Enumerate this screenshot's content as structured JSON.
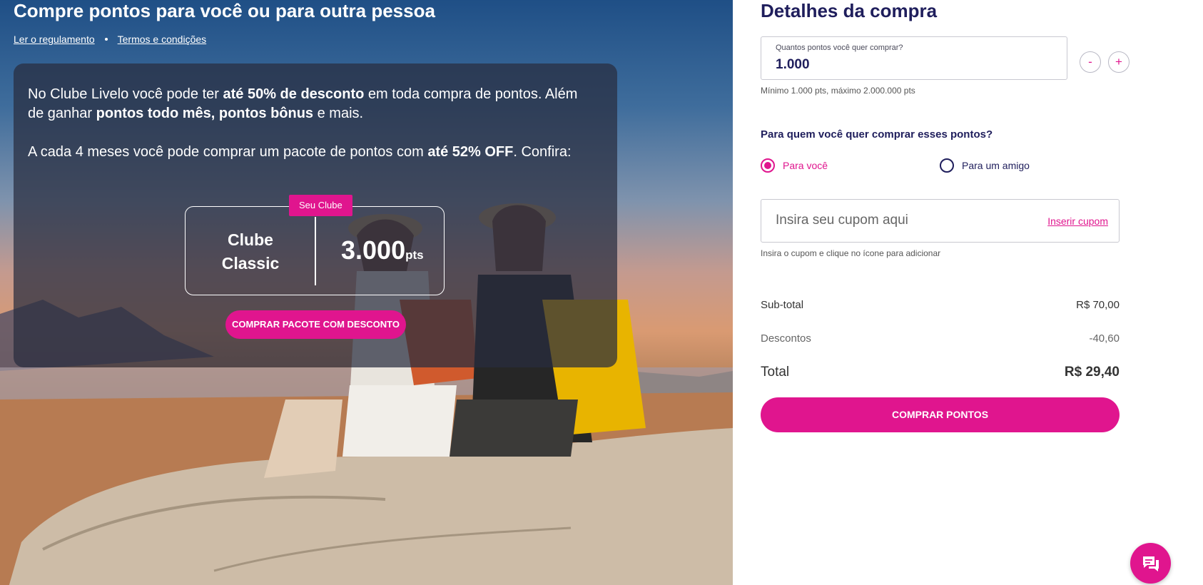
{
  "hero": {
    "title": "Compre pontos para você ou para outra pessoa",
    "links": [
      "Ler o regulamento",
      "Termos e condições"
    ]
  },
  "promo": {
    "p1_parts": [
      "No Clube Livelo você pode ter ",
      "até 50% de desconto",
      " em toda compra de pontos. Além de ganhar ",
      "pontos todo mês, pontos bônus",
      " e mais."
    ],
    "p2_parts": [
      "A cada 4 meses você pode comprar um pacote de pontos com ",
      "até 52% OFF",
      ". Confira:"
    ],
    "badge": "Seu Clube",
    "plan_name": "Clube Classic",
    "points": "3.000",
    "points_unit": "pts",
    "button": "COMPRAR PACOTE COM DESCONTO"
  },
  "panel": {
    "title": "Detalhes da compra",
    "qty_label": "Quantos pontos você quer comprar?",
    "qty_value": "1.000",
    "minus": "-",
    "plus": "+",
    "qty_hint": "Mínimo 1.000 pts, máximo 2.000.000 pts",
    "who_question": "Para quem você quer comprar esses pontos?",
    "radio_you": "Para você",
    "radio_friend": "Para um amigo",
    "coupon_placeholder": "Insira seu cupom aqui",
    "coupon_link": "Inserir cupom",
    "coupon_hint": "Insira o cupom e clique no ícone para adicionar",
    "subtotal_label": "Sub-total",
    "subtotal_value": "R$ 70,00",
    "discount_label": "Descontos",
    "discount_value": "-40,60",
    "total_label": "Total",
    "total_value": "R$ 29,40",
    "buy_button": "COMPRAR PONTOS"
  },
  "colors": {
    "accent": "#e0158e",
    "navy": "#1f1e5c"
  },
  "icons": {
    "chat": "chat-bubble-icon"
  }
}
